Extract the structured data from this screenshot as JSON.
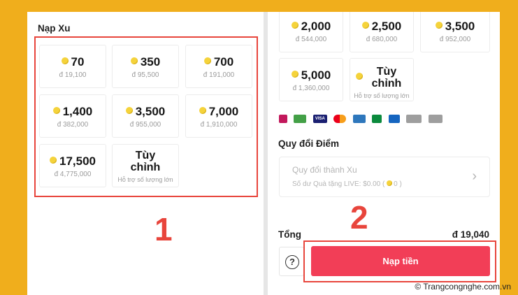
{
  "left": {
    "title": "Nạp Xu",
    "packages": [
      {
        "amount": "70",
        "price": "đ 19,100"
      },
      {
        "amount": "350",
        "price": "đ 95,500"
      },
      {
        "amount": "700",
        "price": "đ 191,000"
      },
      {
        "amount": "1,400",
        "price": "đ 382,000"
      },
      {
        "amount": "3,500",
        "price": "đ 955,000"
      },
      {
        "amount": "7,000",
        "price": "đ 1,910,000"
      },
      {
        "amount": "17,500",
        "price": "đ 4,775,000"
      }
    ],
    "custom": {
      "title_line1": "Tùy",
      "title_line2": "chỉnh",
      "subtitle": "Hỗ trợ số lượng lớn"
    },
    "annotation": "1"
  },
  "right": {
    "packages": [
      {
        "amount": "2,000",
        "price": "đ 544,000"
      },
      {
        "amount": "2,500",
        "price": "đ 680,000"
      },
      {
        "amount": "3,500",
        "price": "đ 952,000"
      },
      {
        "amount": "5,000",
        "price": "đ 1,360,000"
      }
    ],
    "custom": {
      "title_line1": "Tùy",
      "title_line2": "chỉnh",
      "subtitle": "Hỗ trợ số lượng lớn"
    },
    "payment_icons": [
      {
        "name": "wallet-icon",
        "label": "",
        "color": "#c2185b"
      },
      {
        "name": "bank-icon",
        "label": "",
        "color": "#43a047"
      },
      {
        "name": "visa-icon",
        "label": "VISA",
        "color": "#1a1f71"
      },
      {
        "name": "mastercard-icon",
        "label": "",
        "color": "#eb001b"
      },
      {
        "name": "amex-icon",
        "label": "",
        "color": "#2e77bc"
      },
      {
        "name": "jcb-icon",
        "label": "",
        "color": "#0b8a3d"
      },
      {
        "name": "card-icon",
        "label": "",
        "color": "#1565c0"
      },
      {
        "name": "discover-icon",
        "label": "",
        "color": "#666666"
      },
      {
        "name": "diners-icon",
        "label": "",
        "color": "#666666"
      }
    ],
    "exchange_section_title": "Quy đổi Điểm",
    "exchange_card": {
      "label": "Quy đổi thành Xu",
      "sub_prefix": "Số dư Quà tặng LIVE: $0.00 (",
      "sub_count": "0",
      "sub_suffix": ")"
    },
    "total_label": "Tổng",
    "total_value": "đ 19,040",
    "help_symbol": "?",
    "topup_button": "Nạp tiền",
    "annotation": "2"
  },
  "watermark": "© Trangcongnghe.com.vn",
  "colors": {
    "background": "#f0ae1c",
    "accent": "#f23e57",
    "annotation_red": "#e8453c",
    "coin": "#f5d33b"
  }
}
